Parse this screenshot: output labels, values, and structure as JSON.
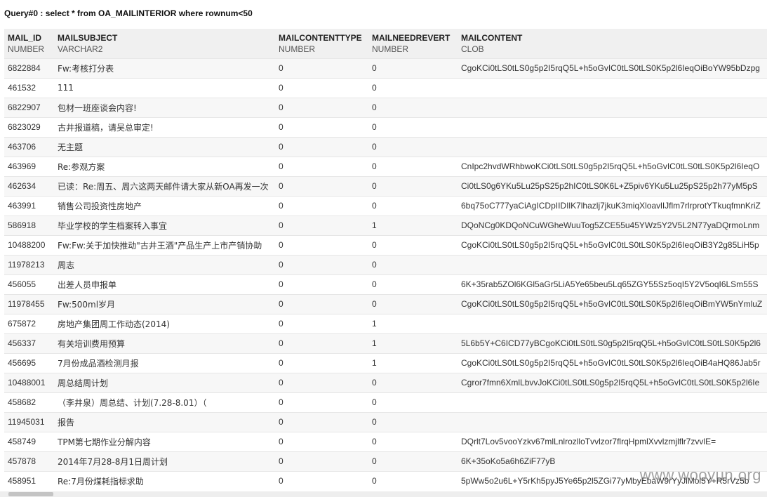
{
  "query": {
    "title": "Query#0 : select * from OA_MAILINTERIOR where rownum<50"
  },
  "columns": [
    {
      "name": "MAIL_ID",
      "type": "NUMBER"
    },
    {
      "name": "MAILSUBJECT",
      "type": "VARCHAR2"
    },
    {
      "name": "MAILCONTENTTYPE",
      "type": "NUMBER"
    },
    {
      "name": "MAILNEEDREVERT",
      "type": "NUMBER"
    },
    {
      "name": "MAILCONTENT",
      "type": "CLOB"
    }
  ],
  "rows": [
    [
      "6822884",
      "Fw:考核打分表",
      "0",
      "0",
      "CgoKCi0tLS0tLS0g5p2I5rqQ5L+h5oGvIC0tLS0tLS0K5p2l6IeqOiBoYW95bDzpg"
    ],
    [
      "461532",
      "111",
      "0",
      "0",
      ""
    ],
    [
      "6822907",
      "包材一班座谈会内容!",
      "0",
      "0",
      ""
    ],
    [
      "6823029",
      "古井报道稿，请吴总审定!",
      "0",
      "0",
      ""
    ],
    [
      "463706",
      "无主题",
      "0",
      "0",
      ""
    ],
    [
      "463969",
      "Re:参观方案",
      "0",
      "0",
      "CnIpc2hvdWRhbwoKCi0tLS0tLS0g5p2I5rqQ5L+h5oGvIC0tLS0tLS0K5p2l6IeqO"
    ],
    [
      "462634",
      "已读：Re:周五、周六这两天邮件请大家从新OA再发一次",
      "0",
      "0",
      "Ci0tLS0g6YKu5Lu25pS25p2hIC0tLS0K6L+Z5piv6YKu5Lu25pS25p2h77yM5pS"
    ],
    [
      "463991",
      "销售公司投资性房地产",
      "0",
      "0",
      "6bq75oC777yaCiAgICDpIIDIlK7lhazlj7jkuK3miqXloavlIJflm7rlrprotYTkuqfmnKriZ"
    ],
    [
      "586918",
      "毕业学校的学生档案转入事宜",
      "0",
      "1",
      "DQoNCg0KDQoNCuWGheWuuTog5ZCE55u45YWz5Y2V5L2N77yaDQrmoLnm"
    ],
    [
      "10488200",
      "Fw:Fw:关于加快推动\"古井王酒\"产品生产上市产销协助",
      "0",
      "0",
      "CgoKCi0tLS0tLS0g5p2I5rqQ5L+h5oGvIC0tLS0tLS0K5p2l6IeqOiB3Y2g85LiH5p"
    ],
    [
      "11978213",
      "周志",
      "0",
      "0",
      ""
    ],
    [
      "456055",
      "出差人员申报单",
      "0",
      "0",
      "6K+35rab5ZOl6KGl5aGr5LiA5Ye65beu5Lq65ZGY55Sz5oqI5Y2V5oqI6LSm55S"
    ],
    [
      "11978455",
      "Fw:500ml岁月",
      "0",
      "0",
      "CgoKCi0tLS0tLS0g5p2I5rqQ5L+h5oGvIC0tLS0tLS0K5p2l6IeqOiBmYW5nYmluZ"
    ],
    [
      "675872",
      "房地产集团周工作动态(2014)",
      "0",
      "1",
      ""
    ],
    [
      "456337",
      "有关培训费用预算",
      "0",
      "1",
      "5L6b5Y+C6ICD77yBCgoKCi0tLS0tLS0g5p2I5rqQ5L+h5oGvIC0tLS0tLS0K5p2l6"
    ],
    [
      "456695",
      "7月份成品酒检测月报",
      "0",
      "1",
      "CgoKCi0tLS0tLS0g5p2I5rqQ5L+h5oGvIC0tLS0tLS0K5p2l6IeqOiB4aHQ86Jab5r"
    ],
    [
      "10488001",
      "周总结周计划",
      "0",
      "0",
      "Cgror7fmn6XmlLbvvJoKCi0tLS0tLS0g5p2I5rqQ5L+h5oGvIC0tLS0tLS0K5p2l6Ie"
    ],
    [
      "458682",
      "（李井泉）周总结、计划(7.28-8.01）（",
      "0",
      "0",
      ""
    ],
    [
      "11945031",
      "报告",
      "0",
      "0",
      ""
    ],
    [
      "458749",
      "TPM第七期作业分解内容",
      "0",
      "0",
      "DQrlt7Lov5vooYzkv67mlLnlrozlloTvvlzor7flrqHpmlXvvlzmjlflr7zvvlE="
    ],
    [
      "457878",
      "2014年7月28-8月1日周计划",
      "0",
      "0",
      "6K+35oKo5a6h6ZiF77yB"
    ],
    [
      "458951",
      "Re:7月份煤耗指标求助",
      "0",
      "0",
      "5pWw5o2u6L+Y5rKh5pyJ5Ye65p2l5ZGi77yMbyEbaW9rYyJlMol5Y+R5rVz5b"
    ]
  ],
  "watermark": {
    "text": "www.wooyun.org"
  }
}
